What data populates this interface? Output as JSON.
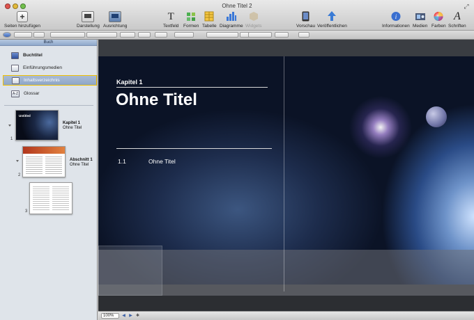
{
  "window": {
    "title": "Ohne Titel 2"
  },
  "toolbar": {
    "add_pages": "Seiten hinzufügen",
    "view": "Darstellung",
    "alignment": "Ausrichtung",
    "textbox": "Textfeld",
    "shapes": "Formen",
    "table": "Tabelle",
    "charts": "Diagramme",
    "widgets": "Widgets",
    "preview": "Vorschau",
    "publish": "Veröffentlichen",
    "info": "Informationen",
    "media": "Medien",
    "colors": "Farben",
    "fonts": "Schriften"
  },
  "sidebar": {
    "header": "Buch",
    "items": [
      {
        "label": "Buchtitel",
        "bold": true
      },
      {
        "label": "Einführungsmedien",
        "bold": false
      },
      {
        "label": "Inhaltsverzeichnis",
        "bold": false,
        "selected": true
      },
      {
        "label": "Glossar",
        "bold": false,
        "icon_text": "A-Z"
      }
    ],
    "chapters": [
      {
        "page": "1",
        "name": "Kapitel 1",
        "title": "Ohne Titel",
        "thumb_title": "Untitled"
      },
      {
        "page": "2",
        "name": "Abschnitt 1",
        "title": "Ohne Titel"
      },
      {
        "page": "3"
      }
    ]
  },
  "page": {
    "chapter_label": "Kapitel 1",
    "title": "Ohne Titel",
    "toc_number": "1.1",
    "toc_text": "Ohne Titel"
  },
  "statusbar": {
    "zoom": "100%"
  },
  "colors": {
    "accent_blue": "#3e63a8",
    "selection_border": "#f0c000"
  }
}
